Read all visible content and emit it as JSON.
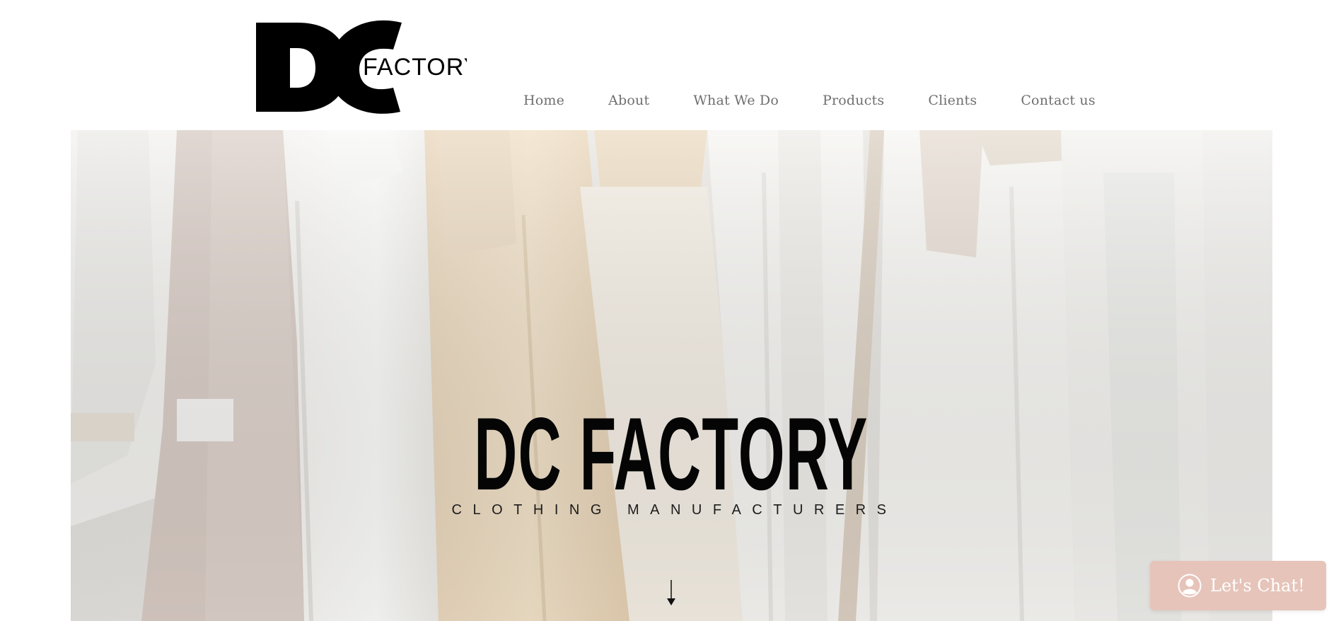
{
  "brand": {
    "logo_letters": "DC",
    "logo_word": "FACTORY"
  },
  "nav": {
    "items": [
      {
        "label": "Home"
      },
      {
        "label": "About"
      },
      {
        "label": "What We Do"
      },
      {
        "label": "Products"
      },
      {
        "label": "Clients"
      },
      {
        "label": "Contact us"
      }
    ]
  },
  "hero": {
    "title": "DC FACTORY",
    "subtitle": "CLOTHING MANUFACTURERS",
    "background": "clothes-rack-photo",
    "scroll_icon": "arrow-down-icon"
  },
  "chat": {
    "label": "Let's Chat!",
    "icon": "user-avatar-icon",
    "color": "#e6c4ba"
  },
  "colors": {
    "nav_text": "#6f6f6f",
    "title_text": "#050505"
  }
}
